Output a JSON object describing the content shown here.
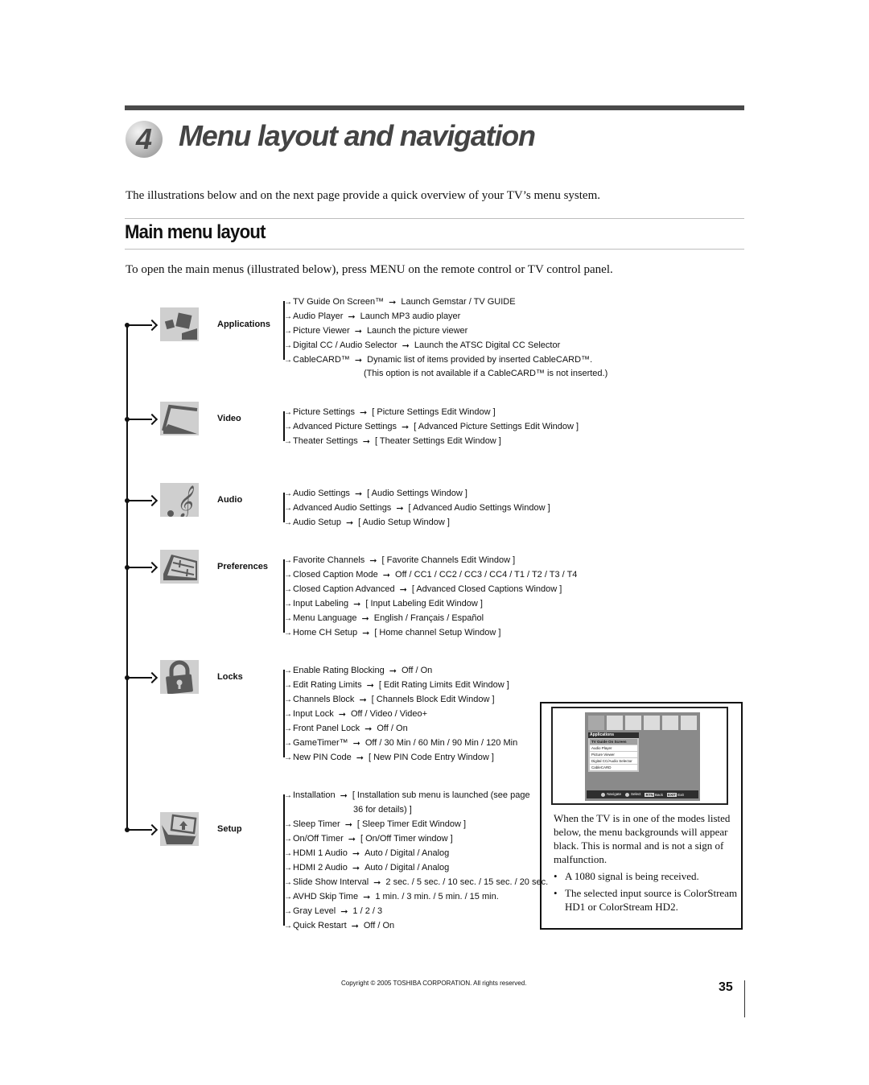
{
  "chapter": {
    "number": "4",
    "title": "Menu layout and navigation"
  },
  "intro": "The illustrations below and on the next page provide a quick overview of your TV’s menu system.",
  "section": {
    "title": "Main menu layout",
    "instruction": "To open the main menus (illustrated below), press MENU on the remote control or TV control panel."
  },
  "arrow_glyph": "➞",
  "menus": [
    {
      "label": "Applications",
      "icon": "applications-icon",
      "items": [
        {
          "name": "TV Guide On Screen™",
          "value": "Launch Gemstar / TV GUIDE"
        },
        {
          "name": "Audio Player",
          "value": "Launch MP3 audio player"
        },
        {
          "name": "Picture Viewer",
          "value": "Launch the picture viewer"
        },
        {
          "name": "Digital CC / Audio Selector",
          "value": "Launch the ATSC Digital CC Selector"
        },
        {
          "name": "CableCARD™",
          "value": "Dynamic list of items provided by inserted CableCARD™."
        }
      ],
      "note": "(This option is not available if a CableCARD™ is not inserted.)"
    },
    {
      "label": "Video",
      "icon": "video-icon",
      "items": [
        {
          "name": "Picture Settings",
          "value": "[ Picture Settings Edit Window ]"
        },
        {
          "name": "Advanced Picture Settings",
          "value": "[ Advanced Picture Settings Edit Window ]"
        },
        {
          "name": "Theater Settings",
          "value": "[ Theater Settings Edit Window ]"
        }
      ]
    },
    {
      "label": "Audio",
      "icon": "audio-icon",
      "items": [
        {
          "name": "Audio Settings",
          "value": "[ Audio Settings Window ]"
        },
        {
          "name": "Advanced Audio Settings",
          "value": "[ Advanced Audio Settings Window ]"
        },
        {
          "name": "Audio Setup",
          "value": "[ Audio Setup Window ]"
        }
      ]
    },
    {
      "label": "Preferences",
      "icon": "preferences-icon",
      "items": [
        {
          "name": "Favorite Channels",
          "value": "[ Favorite Channels Edit Window ]"
        },
        {
          "name": "Closed Caption Mode",
          "value": "Off / CC1 / CC2 / CC3 / CC4 / T1 / T2 / T3 / T4"
        },
        {
          "name": "Closed Caption Advanced",
          "value": "[ Advanced Closed Captions Window ]"
        },
        {
          "name": "Input Labeling",
          "value": "[ Input Labeling Edit Window ]"
        },
        {
          "name": "Menu Language",
          "value": "English / Français / Español"
        },
        {
          "name": "Home CH Setup",
          "value": "[ Home channel Setup Window ]"
        }
      ]
    },
    {
      "label": "Locks",
      "icon": "locks-icon",
      "items": [
        {
          "name": "Enable Rating Blocking",
          "value": "Off / On"
        },
        {
          "name": "Edit Rating Limits",
          "value": "[ Edit Rating Limits Edit Window ]"
        },
        {
          "name": "Channels Block",
          "value": "[ Channels Block Edit Window ]"
        },
        {
          "name": "Input Lock",
          "value": "Off / Video / Video+"
        },
        {
          "name": "Front Panel Lock",
          "value": "Off / On"
        },
        {
          "name": "GameTimer™",
          "value": "Off / 30 Min / 60 Min / 90 Min / 120 Min"
        },
        {
          "name": "New PIN Code",
          "value": "[ New PIN Code Entry Window ]"
        }
      ]
    },
    {
      "label": "Setup",
      "icon": "setup-icon",
      "items": [
        {
          "name": "Installation",
          "value": "[ Installation sub menu is launched (see page"
        },
        {
          "name": "Sleep Timer",
          "value": "[ Sleep Timer Edit Window ]"
        },
        {
          "name": "On/Off Timer",
          "value": "[ On/Off Timer window ]"
        },
        {
          "name": "HDMI 1 Audio",
          "value": "Auto / Digital / Analog"
        },
        {
          "name": "HDMI 2 Audio",
          "value": "Auto / Digital / Analog"
        },
        {
          "name": "Slide Show Interval",
          "value": "2 sec. / 5 sec. / 10 sec. / 15 sec. / 20 sec."
        },
        {
          "name": "AVHD Skip Time",
          "value": "1 min. / 3 min. / 5 min. / 15 min."
        },
        {
          "name": "Gray Level",
          "value": "1 / 2 / 3"
        },
        {
          "name": "Quick Restart",
          "value": "Off / On"
        }
      ],
      "installation_continuation": "36 for details) ]"
    }
  ],
  "tv_screen": {
    "menu_header": "Applications",
    "menu_items": [
      "TV Guide On Screen",
      "Audio Player",
      "Picture Viewer",
      "Digital CC/Audio Selector",
      "CableCARD"
    ],
    "selected_index": 0,
    "footer": {
      "navigate": "Navigate",
      "select": "Select",
      "back_key": "RTN",
      "back": "Back",
      "exit_key": "EXIT",
      "exit": "Exit"
    }
  },
  "note_box": {
    "text": "When the TV is in one of the modes listed below, the menu backgrounds will appear black. This is normal and is not a sign of malfunction.",
    "bullets": [
      "A 1080 signal is being received.",
      "The selected input source is ColorStream HD1 or ColorStream HD2."
    ],
    "bullet_glyph": "•"
  },
  "footer": {
    "copyright": "Copyright © 2005 TOSHIBA CORPORATION. All rights reserved.",
    "page_number": "35"
  }
}
